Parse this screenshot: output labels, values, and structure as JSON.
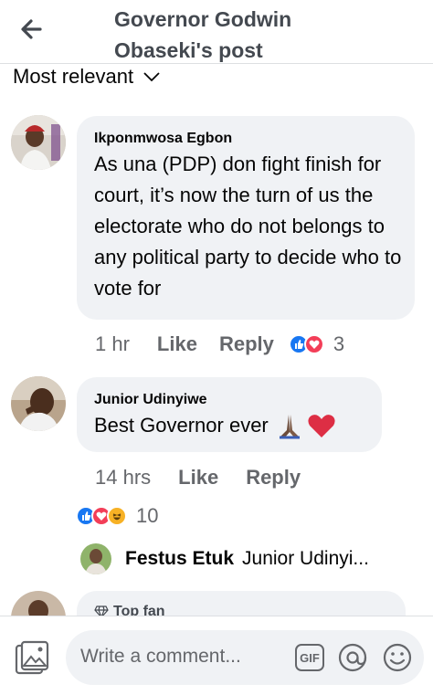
{
  "header": {
    "title": "Governor Godwin Obaseki's post",
    "back_icon": "back-arrow-icon"
  },
  "sort": {
    "label": "Most relevant",
    "icon": "chevron-down-icon"
  },
  "comments": [
    {
      "author": "Ikponmwosa Egbon",
      "text": "As una (PDP) don fight finish for court, it’s now  the turn of us the electorate who do not belongs to any political party to decide who to vote for",
      "time": "1 hr",
      "like": "Like",
      "reply": "Reply",
      "reaction_count": "3",
      "reactions": [
        "like",
        "love"
      ]
    },
    {
      "author": "Junior Udinyiwe",
      "text": "Best Governor ever",
      "emoji": "praying-hands + red-heart",
      "time": "14 hrs",
      "like": "Like",
      "reply": "Reply",
      "reaction_count": "10",
      "reactions": [
        "like",
        "love",
        "haha"
      ]
    }
  ],
  "reply_preview": {
    "author": "Festus Etuk",
    "text": "Junior Udinyi..."
  },
  "partial_comment": {
    "badge": "Top fan"
  },
  "composer": {
    "placeholder": "Write a comment...",
    "gif_label": "GIF"
  },
  "colors": {
    "bubble": "#f0f2f5",
    "meta_text": "#65676b",
    "like_blue": "#1877f2",
    "love_red": "#f33e58",
    "haha_yellow": "#f7b125"
  }
}
